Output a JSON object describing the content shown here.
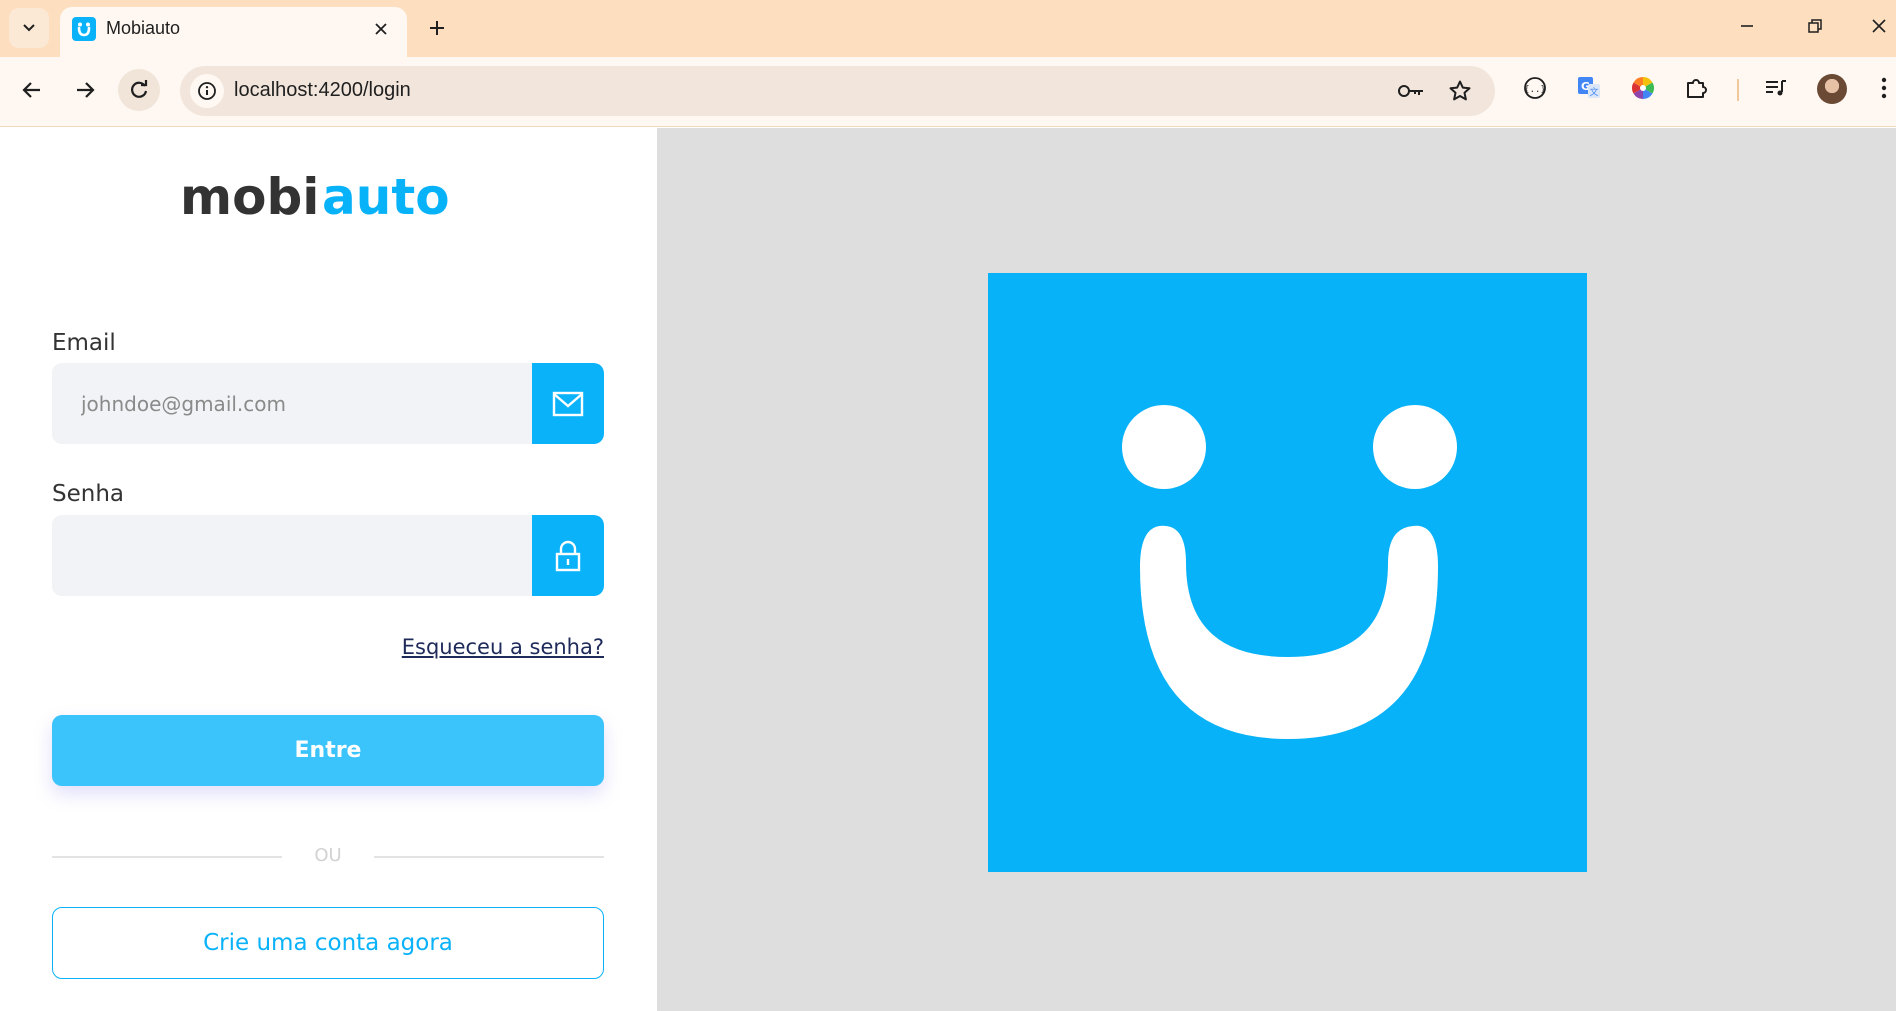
{
  "browser": {
    "tab_title": "Mobiauto",
    "url": "localhost:4200/login",
    "icons": {
      "tab_search": "chevron-down-icon",
      "tab_close": "close-icon",
      "new_tab": "plus-icon",
      "minimize": "minimize-icon",
      "restore": "restore-icon",
      "close_window": "close-icon",
      "back": "arrow-left-icon",
      "forward": "arrow-right-icon",
      "reload": "reload-icon",
      "site_info": "info-icon",
      "passwords": "key-icon",
      "bookmark": "star-icon",
      "extensions": [
        "code-extension-icon",
        "translate-icon",
        "color-wheel-icon",
        "puzzle-icon",
        "media-playlist-icon"
      ],
      "profile": "avatar",
      "menu": "more-vertical-icon"
    }
  },
  "login": {
    "logo_mobi": "mobi",
    "logo_auto": "auto",
    "email_label": "Email",
    "email_placeholder": "johndoe@gmail.com",
    "email_value": "",
    "password_label": "Senha",
    "password_value": "",
    "forgot_link": "Esqueceu a senha?",
    "submit_label": "Entre",
    "divider_text": "OU",
    "create_account_label": "Crie uma conta agora",
    "icons": {
      "email": "mail-icon",
      "password": "lock-icon"
    }
  },
  "colors": {
    "brand": "#08b2f8",
    "submit": "#3bc3fb",
    "logo_dark": "#333333",
    "panel_bg": "#dedede",
    "tabbar_bg": "#fddfc0"
  }
}
